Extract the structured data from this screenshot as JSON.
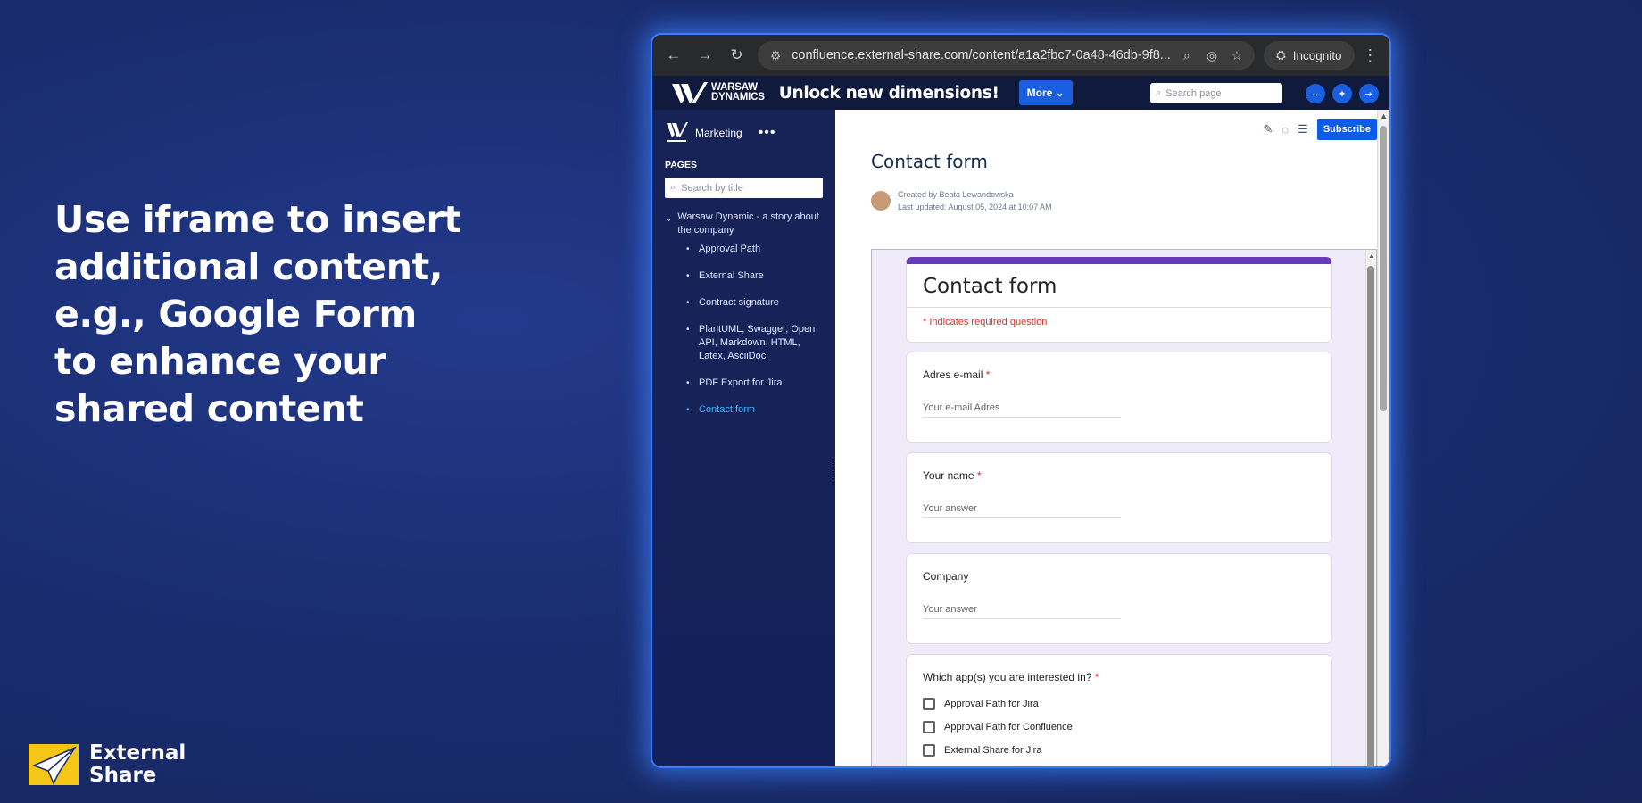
{
  "headline": {
    "lines": [
      "Use iframe to insert",
      "additional content,",
      "e.g., Google Form",
      "to enhance your",
      "shared content"
    ]
  },
  "brand": {
    "line1": "External",
    "line2": "Share"
  },
  "browser": {
    "url": "confluence.external-share.com/content/a1a2fbc7-0a48-46db-9f8...",
    "incognito_label": "Incognito"
  },
  "header": {
    "logo_line1": "WARSAW",
    "logo_line2": "DYNAMICS",
    "tagline": "Unlock new dimensions!",
    "more_label": "More",
    "search_placeholder": "Search page"
  },
  "sidebar": {
    "space_name": "Marketing",
    "pages_label": "PAGES",
    "search_placeholder": "Search by title",
    "root": "Warsaw Dynamic - a story about the company",
    "items": [
      {
        "label": "Approval Path"
      },
      {
        "label": "External Share"
      },
      {
        "label": "Contract signature"
      },
      {
        "label": "PlantUML, Swagger, Open API, Markdown, HTML, Latex, AsciiDoc"
      },
      {
        "label": "PDF Export for Jira"
      },
      {
        "label": "Contact form"
      }
    ]
  },
  "content": {
    "subscribe_label": "Subscribe",
    "title": "Contact form",
    "created_by": "Created by Beata Lewandowska",
    "last_updated": "Last updated: August 05, 2024 at 10:07 AM"
  },
  "form": {
    "title": "Contact form",
    "required_note": "* Indicates required question",
    "q_email": "Adres e-mail",
    "q_email_placeholder": "Your e-mail Adres",
    "q_name": "Your name",
    "q_name_placeholder": "Your answer",
    "q_company": "Company",
    "q_company_placeholder": "Your answer",
    "q_apps": "Which app(s) you are interested in?",
    "options": [
      "Approval Path for Jira",
      "Approval Path for Confluence",
      "External Share for Jira"
    ],
    "required_mark": "*"
  },
  "colors": {
    "form_accent": "#673ab7",
    "required": "#d93025",
    "button_blue": "#0c5ce8",
    "active_link": "#3fb6ff"
  }
}
